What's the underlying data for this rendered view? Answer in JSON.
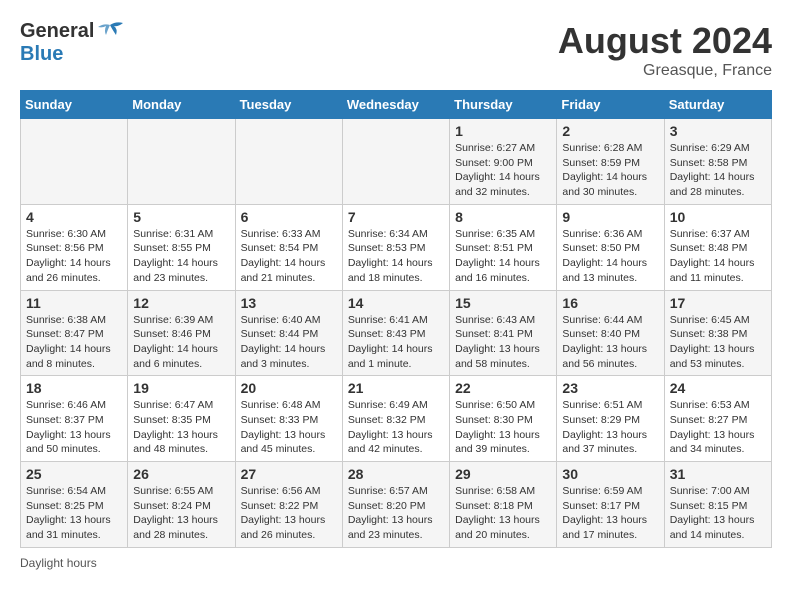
{
  "header": {
    "logo_line1": "General",
    "logo_line2": "Blue",
    "month_title": "August 2024",
    "location": "Greasque, France"
  },
  "days_of_week": [
    "Sunday",
    "Monday",
    "Tuesday",
    "Wednesday",
    "Thursday",
    "Friday",
    "Saturday"
  ],
  "weeks": [
    [
      {
        "day": "",
        "info": ""
      },
      {
        "day": "",
        "info": ""
      },
      {
        "day": "",
        "info": ""
      },
      {
        "day": "",
        "info": ""
      },
      {
        "day": "1",
        "info": "Sunrise: 6:27 AM\nSunset: 9:00 PM\nDaylight: 14 hours\nand 32 minutes."
      },
      {
        "day": "2",
        "info": "Sunrise: 6:28 AM\nSunset: 8:59 PM\nDaylight: 14 hours\nand 30 minutes."
      },
      {
        "day": "3",
        "info": "Sunrise: 6:29 AM\nSunset: 8:58 PM\nDaylight: 14 hours\nand 28 minutes."
      }
    ],
    [
      {
        "day": "4",
        "info": "Sunrise: 6:30 AM\nSunset: 8:56 PM\nDaylight: 14 hours\nand 26 minutes."
      },
      {
        "day": "5",
        "info": "Sunrise: 6:31 AM\nSunset: 8:55 PM\nDaylight: 14 hours\nand 23 minutes."
      },
      {
        "day": "6",
        "info": "Sunrise: 6:33 AM\nSunset: 8:54 PM\nDaylight: 14 hours\nand 21 minutes."
      },
      {
        "day": "7",
        "info": "Sunrise: 6:34 AM\nSunset: 8:53 PM\nDaylight: 14 hours\nand 18 minutes."
      },
      {
        "day": "8",
        "info": "Sunrise: 6:35 AM\nSunset: 8:51 PM\nDaylight: 14 hours\nand 16 minutes."
      },
      {
        "day": "9",
        "info": "Sunrise: 6:36 AM\nSunset: 8:50 PM\nDaylight: 14 hours\nand 13 minutes."
      },
      {
        "day": "10",
        "info": "Sunrise: 6:37 AM\nSunset: 8:48 PM\nDaylight: 14 hours\nand 11 minutes."
      }
    ],
    [
      {
        "day": "11",
        "info": "Sunrise: 6:38 AM\nSunset: 8:47 PM\nDaylight: 14 hours\nand 8 minutes."
      },
      {
        "day": "12",
        "info": "Sunrise: 6:39 AM\nSunset: 8:46 PM\nDaylight: 14 hours\nand 6 minutes."
      },
      {
        "day": "13",
        "info": "Sunrise: 6:40 AM\nSunset: 8:44 PM\nDaylight: 14 hours\nand 3 minutes."
      },
      {
        "day": "14",
        "info": "Sunrise: 6:41 AM\nSunset: 8:43 PM\nDaylight: 14 hours\nand 1 minute."
      },
      {
        "day": "15",
        "info": "Sunrise: 6:43 AM\nSunset: 8:41 PM\nDaylight: 13 hours\nand 58 minutes."
      },
      {
        "day": "16",
        "info": "Sunrise: 6:44 AM\nSunset: 8:40 PM\nDaylight: 13 hours\nand 56 minutes."
      },
      {
        "day": "17",
        "info": "Sunrise: 6:45 AM\nSunset: 8:38 PM\nDaylight: 13 hours\nand 53 minutes."
      }
    ],
    [
      {
        "day": "18",
        "info": "Sunrise: 6:46 AM\nSunset: 8:37 PM\nDaylight: 13 hours\nand 50 minutes."
      },
      {
        "day": "19",
        "info": "Sunrise: 6:47 AM\nSunset: 8:35 PM\nDaylight: 13 hours\nand 48 minutes."
      },
      {
        "day": "20",
        "info": "Sunrise: 6:48 AM\nSunset: 8:33 PM\nDaylight: 13 hours\nand 45 minutes."
      },
      {
        "day": "21",
        "info": "Sunrise: 6:49 AM\nSunset: 8:32 PM\nDaylight: 13 hours\nand 42 minutes."
      },
      {
        "day": "22",
        "info": "Sunrise: 6:50 AM\nSunset: 8:30 PM\nDaylight: 13 hours\nand 39 minutes."
      },
      {
        "day": "23",
        "info": "Sunrise: 6:51 AM\nSunset: 8:29 PM\nDaylight: 13 hours\nand 37 minutes."
      },
      {
        "day": "24",
        "info": "Sunrise: 6:53 AM\nSunset: 8:27 PM\nDaylight: 13 hours\nand 34 minutes."
      }
    ],
    [
      {
        "day": "25",
        "info": "Sunrise: 6:54 AM\nSunset: 8:25 PM\nDaylight: 13 hours\nand 31 minutes."
      },
      {
        "day": "26",
        "info": "Sunrise: 6:55 AM\nSunset: 8:24 PM\nDaylight: 13 hours\nand 28 minutes."
      },
      {
        "day": "27",
        "info": "Sunrise: 6:56 AM\nSunset: 8:22 PM\nDaylight: 13 hours\nand 26 minutes."
      },
      {
        "day": "28",
        "info": "Sunrise: 6:57 AM\nSunset: 8:20 PM\nDaylight: 13 hours\nand 23 minutes."
      },
      {
        "day": "29",
        "info": "Sunrise: 6:58 AM\nSunset: 8:18 PM\nDaylight: 13 hours\nand 20 minutes."
      },
      {
        "day": "30",
        "info": "Sunrise: 6:59 AM\nSunset: 8:17 PM\nDaylight: 13 hours\nand 17 minutes."
      },
      {
        "day": "31",
        "info": "Sunrise: 7:00 AM\nSunset: 8:15 PM\nDaylight: 13 hours\nand 14 minutes."
      }
    ]
  ],
  "footer": {
    "daylight_label": "Daylight hours"
  }
}
